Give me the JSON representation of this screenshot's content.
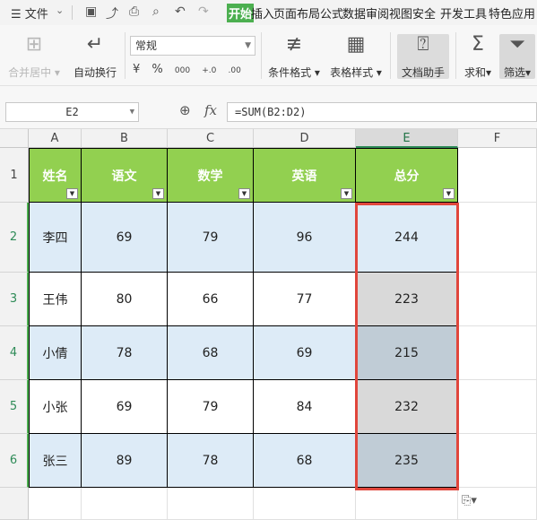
{
  "menubar": {
    "file_label": "文件",
    "tabs": [
      "开始",
      "插入",
      "页面布局",
      "公式",
      "数据",
      "审阅",
      "视图",
      "安全",
      "开发工具",
      "特色应用"
    ],
    "active_tab": "开始"
  },
  "ribbon": {
    "merge_label": "合并居中",
    "wrap_label": "自动换行",
    "number_format": "常规",
    "number_buttons": [
      "¥",
      "%",
      "000",
      "+.0",
      ".00"
    ],
    "cond_format_label": "条件格式",
    "table_style_label": "表格样式",
    "doc_assist_label": "文档助手",
    "sum_label": "求和",
    "filter_label": "筛选"
  },
  "formula_bar": {
    "cell_ref": "E2",
    "fx_label": "fx",
    "formula": "=SUM(B2:D2)"
  },
  "sheet": {
    "columns": [
      "A",
      "B",
      "C",
      "D",
      "E",
      "F"
    ],
    "selected_column": "E",
    "rows": [
      "1",
      "2",
      "3",
      "4",
      "5",
      "6"
    ],
    "headers": [
      "姓名",
      "语文",
      "数学",
      "英语",
      "总分"
    ],
    "data": [
      [
        "李四",
        "69",
        "79",
        "96",
        "244"
      ],
      [
        "王伟",
        "80",
        "66",
        "77",
        "223"
      ],
      [
        "小倩",
        "78",
        "68",
        "69",
        "215"
      ],
      [
        "小张",
        "69",
        "79",
        "84",
        "232"
      ],
      [
        "张三",
        "89",
        "78",
        "68",
        "235"
      ]
    ]
  },
  "colors": {
    "header_fill": "#92d050",
    "row_band": "#ddebf7",
    "selection_border": "#e0463c",
    "accent": "#4caf50"
  }
}
